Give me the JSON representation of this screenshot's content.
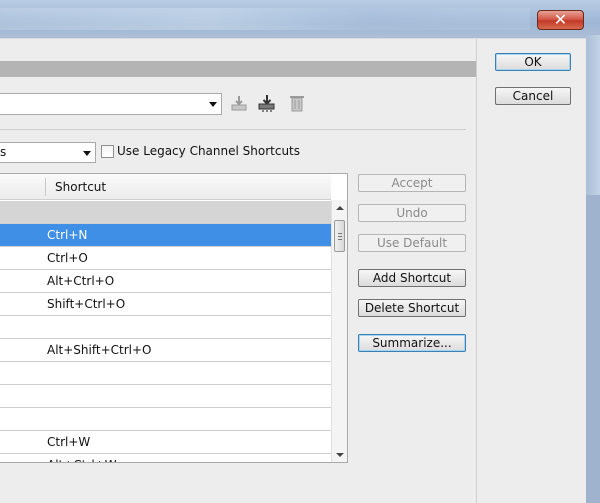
{
  "window": {
    "close_glyph": "✕"
  },
  "dialog": {
    "ok_label": "OK",
    "cancel_label": "Cancel"
  },
  "set": {
    "value": ""
  },
  "for_select": {
    "value": "s"
  },
  "legacy": {
    "label": "Use Legacy Channel Shortcuts",
    "checked": false
  },
  "table": {
    "col_shortcut": "Shortcut",
    "rows": [
      {
        "shortcut": "",
        "type": "group"
      },
      {
        "shortcut": "Ctrl+N",
        "type": "selected"
      },
      {
        "shortcut": "Ctrl+O",
        "type": "normal"
      },
      {
        "shortcut": "Alt+Ctrl+O",
        "type": "normal"
      },
      {
        "shortcut": "Shift+Ctrl+O",
        "type": "normal"
      },
      {
        "shortcut": "",
        "type": "normal"
      },
      {
        "shortcut": "Alt+Shift+Ctrl+O",
        "type": "normal"
      },
      {
        "shortcut": "",
        "type": "normal"
      },
      {
        "shortcut": "",
        "type": "normal"
      },
      {
        "shortcut": "",
        "type": "normal"
      },
      {
        "shortcut": "Ctrl+W",
        "type": "normal"
      },
      {
        "shortcut": "Alt+Ctrl+W",
        "type": "normal"
      }
    ]
  },
  "buttons": {
    "accept": "Accept",
    "undo": "Undo",
    "use_default": "Use Default",
    "add_shortcut": "Add Shortcut",
    "delete_shortcut": "Delete Shortcut",
    "summarize": "Summarize..."
  },
  "colors": {
    "selection": "#3f8fe6",
    "group_row": "#d5d5d5"
  }
}
